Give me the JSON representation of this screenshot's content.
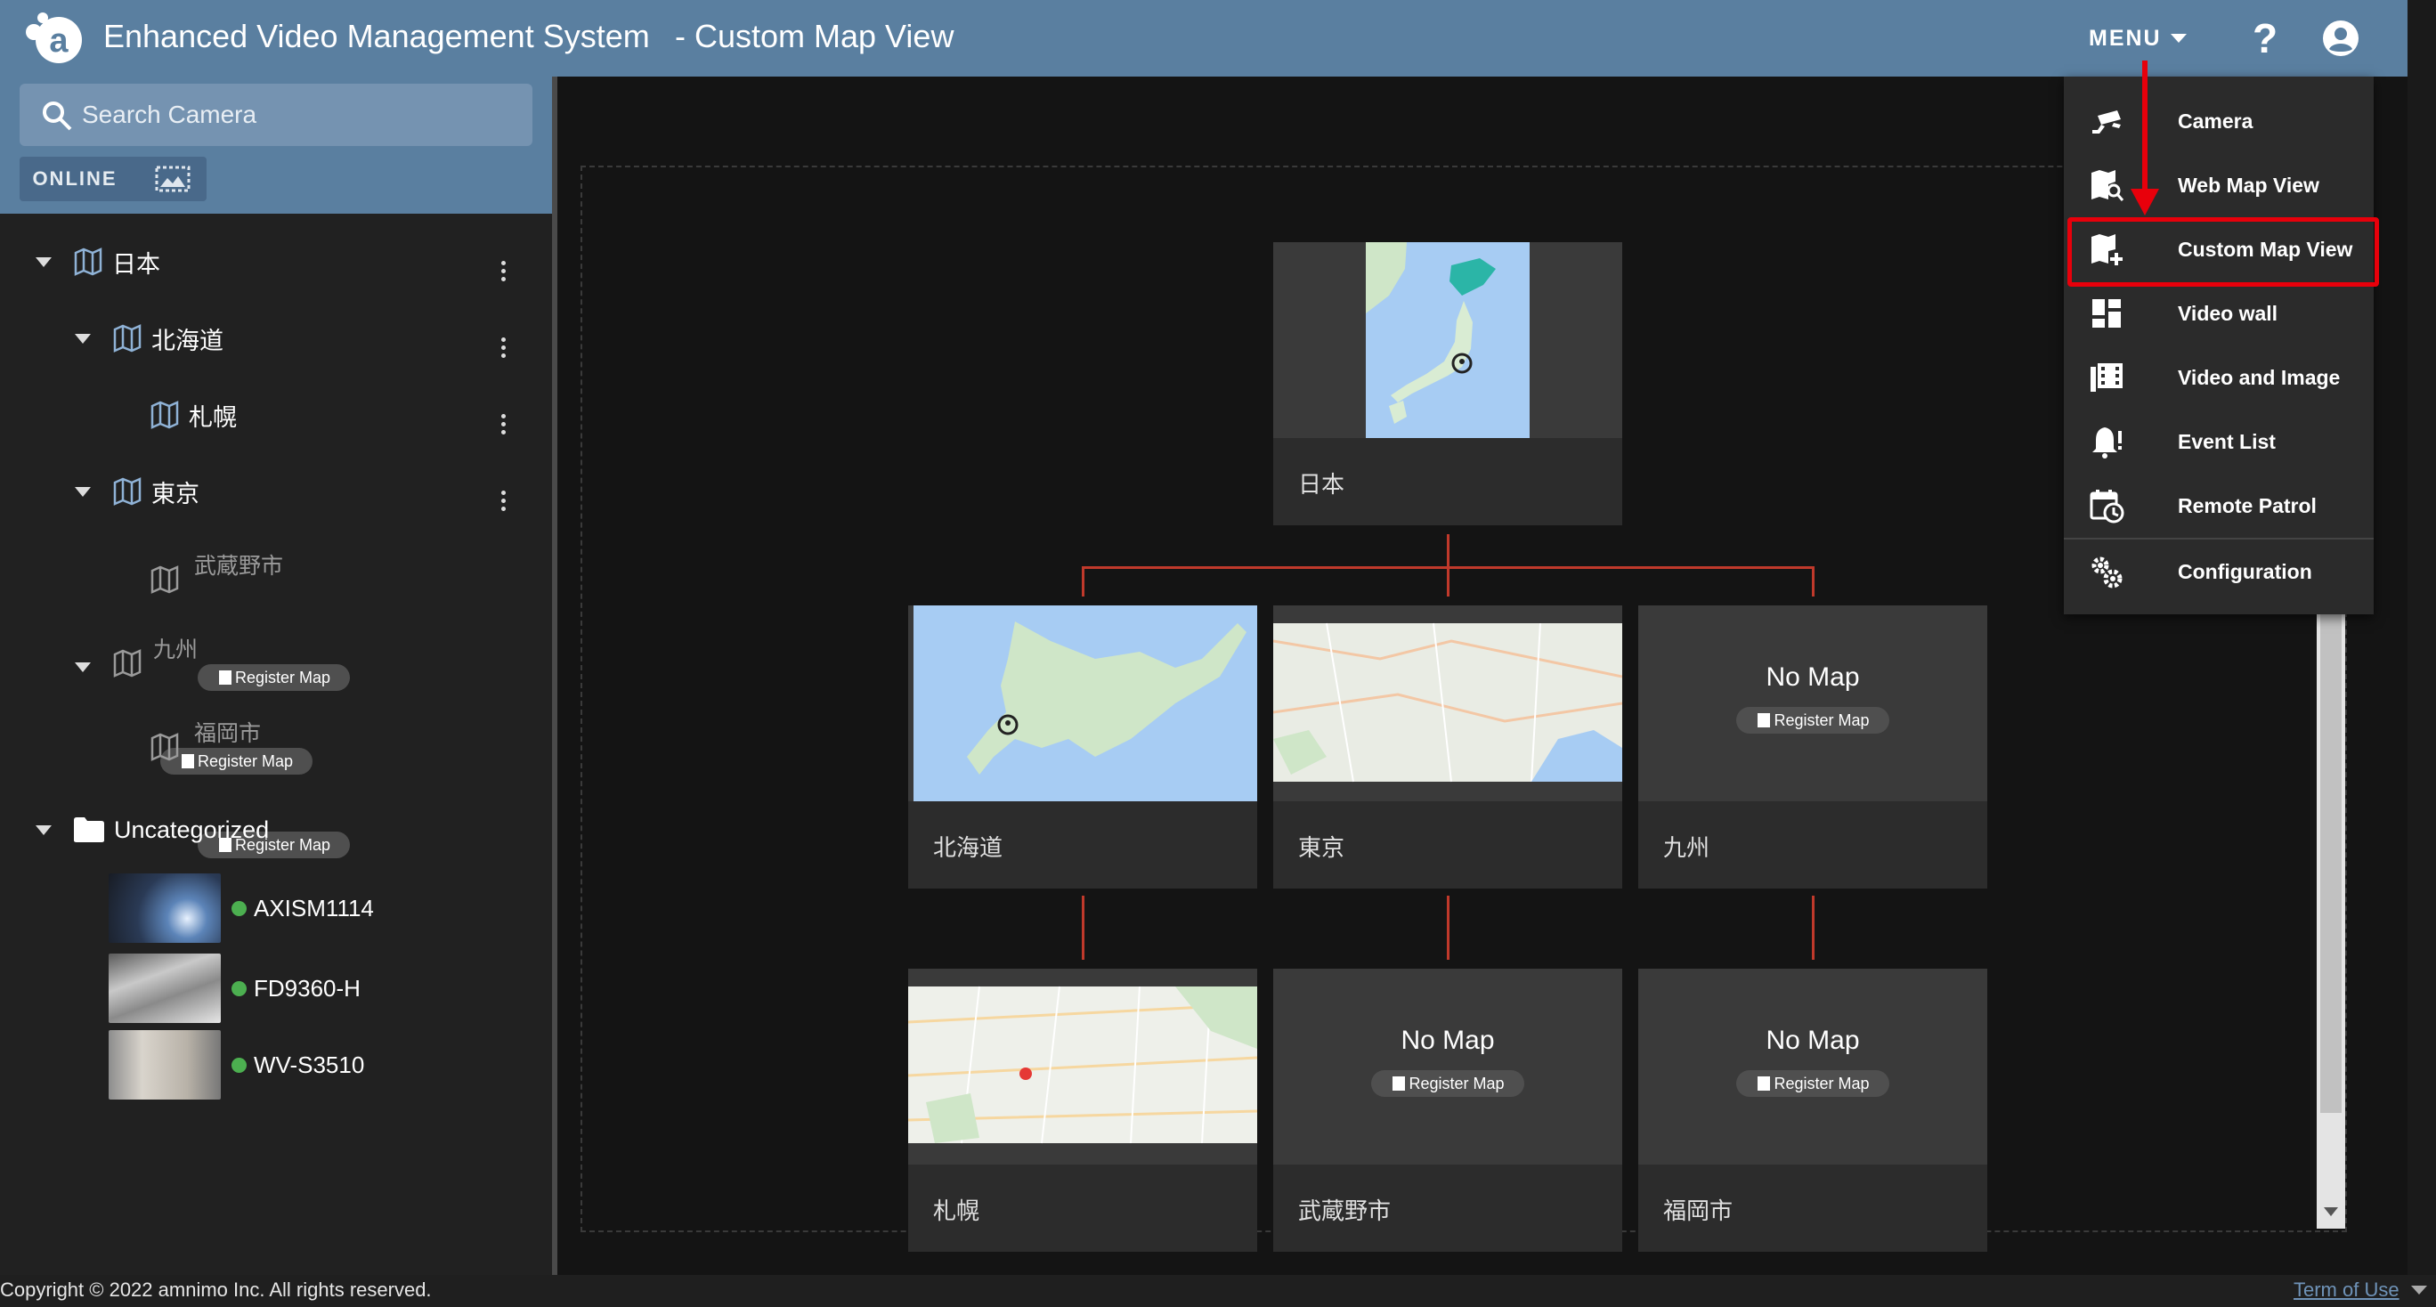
{
  "header": {
    "app_title": "Enhanced Video Management System",
    "page_title": "- Custom Map View",
    "menu_label": "MENU",
    "help_label": "?",
    "brand_color": "#5a7fa0"
  },
  "sidebar": {
    "search_placeholder": "Search Camera",
    "online_label": "ONLINE",
    "tree": {
      "japan": "日本",
      "hokkaido": "北海道",
      "sapporo": "札幌",
      "tokyo": "東京",
      "musashino": "武蔵野市",
      "kyushu": "九州",
      "fukuoka": "福岡市",
      "uncategorized": "Uncategorized"
    },
    "register_map_label": "Register Map",
    "cameras": [
      {
        "name": "AXISM1114",
        "status": "online"
      },
      {
        "name": "FD9360-H",
        "status": "online"
      },
      {
        "name": "WV-S3510",
        "status": "online"
      }
    ],
    "status_color": "#4caf50"
  },
  "map_tree": {
    "root": {
      "label": "日本"
    },
    "level2": [
      {
        "label": "北海道"
      },
      {
        "label": "東京"
      },
      {
        "label": "九州",
        "no_map": "No Map",
        "register": "Register Map"
      }
    ],
    "level3": [
      {
        "label": "札幌"
      },
      {
        "label": "武蔵野市",
        "no_map": "No Map",
        "register": "Register Map"
      },
      {
        "label": "福岡市",
        "no_map": "No Map",
        "register": "Register Map"
      }
    ],
    "connector_color": "#c0392b"
  },
  "menu": {
    "items": [
      {
        "label": "Camera",
        "icon": "cctv-icon"
      },
      {
        "label": "Web Map View",
        "icon": "map-search-icon"
      },
      {
        "label": "Custom Map View",
        "icon": "map-plus-icon"
      },
      {
        "label": "Video wall",
        "icon": "dashboard-icon"
      },
      {
        "label": "Video and Image",
        "icon": "film-icon"
      },
      {
        "label": "Event List",
        "icon": "bell-alert-icon"
      },
      {
        "label": "Remote Patrol",
        "icon": "calendar-clock-icon"
      },
      {
        "label": "Configuration",
        "icon": "cogs-icon"
      }
    ],
    "highlight_color": "#e8000b"
  },
  "footer": {
    "copyright": "Copyright © 2022 amnimo Inc. All rights reserved.",
    "terms": "Term of Use"
  }
}
